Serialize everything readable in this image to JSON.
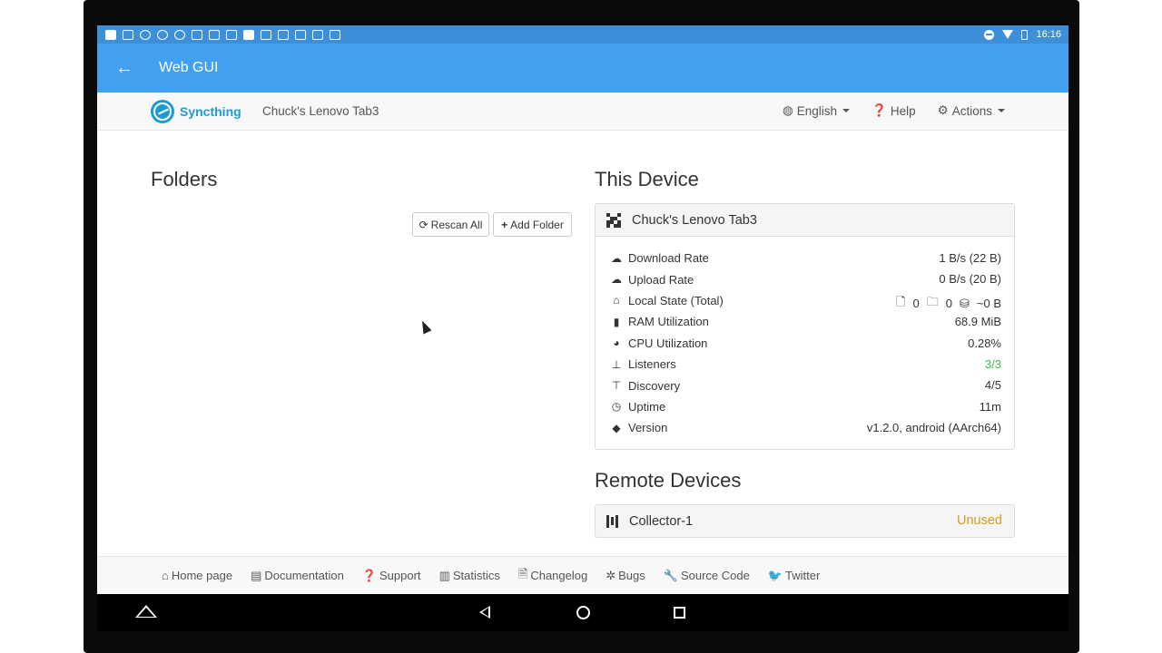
{
  "statusbar": {
    "time": "16:16"
  },
  "appbar": {
    "title": "Web GUI"
  },
  "navbar": {
    "brand": "Syncthing",
    "device_name": "Chuck's Lenovo Tab3",
    "language": "English",
    "help": "Help",
    "actions": "Actions"
  },
  "folders": {
    "heading": "Folders",
    "rescan_all": "Rescan All",
    "add_folder": "Add Folder"
  },
  "this_device": {
    "heading": "This Device",
    "name": "Chuck's Lenovo Tab3",
    "rows": [
      {
        "label": "Download Rate",
        "value": "1 B/s (22 B)"
      },
      {
        "label": "Upload Rate",
        "value": "0 B/s (20 B)"
      },
      {
        "label": "Local State (Total)",
        "files": "0",
        "dirs": "0",
        "size": "~0 B"
      },
      {
        "label": "RAM Utilization",
        "value": "68.9 MiB"
      },
      {
        "label": "CPU Utilization",
        "value": "0.28%"
      },
      {
        "label": "Listeners",
        "value": "3/3"
      },
      {
        "label": "Discovery",
        "value": "4/5"
      },
      {
        "label": "Uptime",
        "value": "11m"
      },
      {
        "label": "Version",
        "value": "v1.2.0, android (AArch64)"
      }
    ]
  },
  "remote_devices": {
    "heading": "Remote Devices",
    "items": [
      {
        "name": "Collector-1",
        "status": "Unused"
      }
    ]
  },
  "footer": {
    "links": [
      "Home page",
      "Documentation",
      "Support",
      "Statistics",
      "Changelog",
      "Bugs",
      "Source Code",
      "Twitter"
    ]
  },
  "colors": {
    "appbar": "#42a0f0",
    "statusbar": "#3d8fd8",
    "brand": "#1d9bd1",
    "green": "#3fb950",
    "unused": "#d59e1c"
  }
}
